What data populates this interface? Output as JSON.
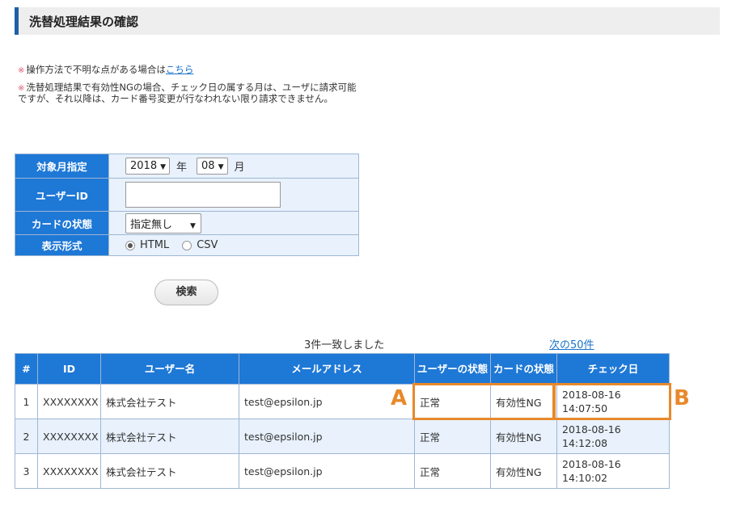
{
  "header": {
    "title": "洗替処理結果の確認"
  },
  "notes": [
    {
      "mark": "※",
      "text": "操作方法で不明な点がある場合は",
      "link": "こちら"
    },
    {
      "mark": "※",
      "text": "洗替処理結果で有効性NGの場合、チェック日の属する月は、ユーザに請求可能ですが、それ以降は、カード番号変更が行なわれない限り請求できません。"
    }
  ],
  "form": {
    "target_month_label": "対象月指定",
    "year_value": "2018",
    "year_unit": "年",
    "month_value": "08",
    "month_unit": "月",
    "user_id_label": "ユーザーID",
    "user_id_value": "",
    "card_status_label": "カードの状態",
    "card_status_value": "指定無し",
    "format_label": "表示形式",
    "format_options": [
      "HTML",
      "CSV"
    ],
    "format_selected": "HTML"
  },
  "search_button": "検索",
  "results": {
    "count_text": "3件一致しました",
    "next_link": "次の50件",
    "columns": [
      "#",
      "ID",
      "ユーザー名",
      "メールアドレス",
      "ユーザーの状態",
      "カードの状態",
      "チェック日"
    ],
    "rows": [
      {
        "num": "1",
        "id": "XXXXXXXX",
        "name": "株式会社テスト",
        "email": "test@epsilon.jp",
        "user_status": "正常",
        "card_status": "有効性NG",
        "check_date": "2018-08-16",
        "check_time": "14:07:50"
      },
      {
        "num": "2",
        "id": "XXXXXXXX",
        "name": "株式会社テスト",
        "email": "test@epsilon.jp",
        "user_status": "正常",
        "card_status": "有効性NG",
        "check_date": "2018-08-16",
        "check_time": "14:12:08"
      },
      {
        "num": "3",
        "id": "XXXXXXXX",
        "name": "株式会社テスト",
        "email": "test@epsilon.jp",
        "user_status": "正常",
        "card_status": "有効性NG",
        "check_date": "2018-08-16",
        "check_time": "14:10:02"
      }
    ]
  },
  "callouts": {
    "a": "A",
    "b": "B",
    "color": "#e8892b"
  },
  "colors": {
    "accent": "#1e78d6",
    "row_alt": "#e8f1fc",
    "link": "#1a73c9"
  }
}
